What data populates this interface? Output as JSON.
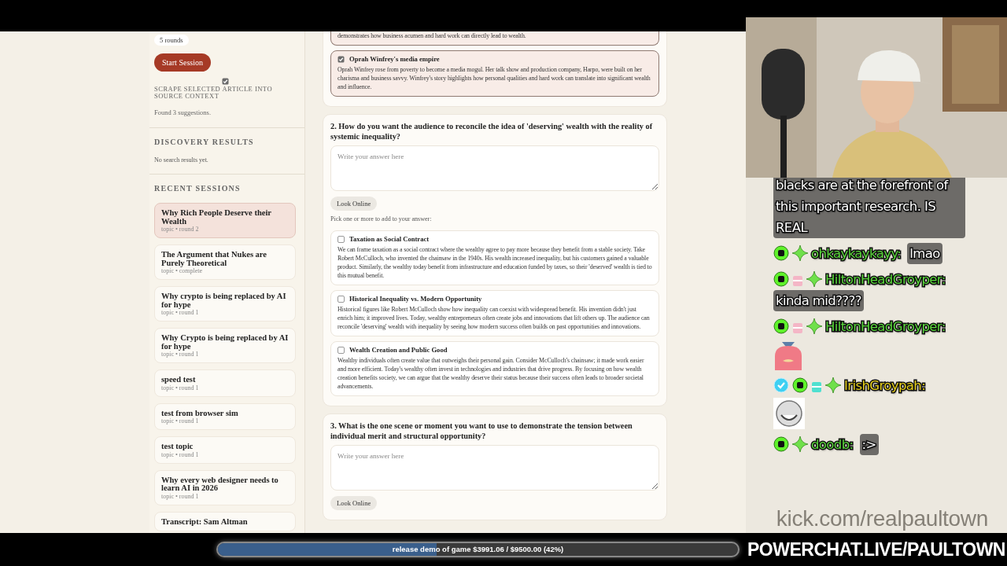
{
  "sidebar": {
    "rounds_chip": "5 rounds",
    "start_button": "Start Session",
    "scrape_option": {
      "label": "SCRAPE SELECTED ARTICLE INTO SOURCE CONTEXT",
      "checked": true
    },
    "status": "Found 3 suggestions.",
    "discovery": {
      "heading": "DISCOVERY RESULTS",
      "empty_text": "No search results yet."
    },
    "recent": {
      "heading": "RECENT SESSIONS",
      "sessions": [
        {
          "title": "Why Rich People Deserve their Wealth",
          "meta": "topic • round 2",
          "selected": true
        },
        {
          "title": "The Argument that Nukes are Purely Theoretical",
          "meta": "topic • complete",
          "selected": false
        },
        {
          "title": "Why crypto is being replaced by AI for hype",
          "meta": "topic • round 1",
          "selected": false
        },
        {
          "title": "Why Crypto is being replaced by AI for hype",
          "meta": "topic • round 1",
          "selected": false
        },
        {
          "title": "speed test",
          "meta": "topic • round 1",
          "selected": false
        },
        {
          "title": "test from browser sim",
          "meta": "topic • round 1",
          "selected": false
        },
        {
          "title": "test topic",
          "meta": "topic • round 1",
          "selected": false
        },
        {
          "title": "Why every web designer needs to learn AI in 2026",
          "meta": "topic • round 1",
          "selected": false
        },
        {
          "title": "Transcript: Sam Altman",
          "selected": false
        }
      ]
    }
  },
  "questions": [
    {
      "suggestions": [
        {
          "text": "demonstrates how business acumen and hard work can directly lead to wealth.",
          "checked": true
        },
        {
          "title": "Oprah Winfrey's media empire",
          "text": "Oprah Winfrey rose from poverty to become a media mogul. Her talk show and production company, Harpo, were built on her charisma and business savvy. Winfrey's story highlights how personal qualities and hard work can translate into significant wealth and influence.",
          "checked": true
        }
      ]
    },
    {
      "prompt": "2. How do you want the audience to reconcile the idea of 'deserving' wealth with the reality of systemic inequality?",
      "placeholder": "Write your answer here",
      "look_online": "Look Online",
      "pick_hint": "Pick one or more to add to your answer:",
      "suggestions": [
        {
          "title": "Taxation as Social Contract",
          "text": "We can frame taxation as a social contract where the wealthy agree to pay more because they benefit from a stable society. Take Robert McCulloch, who invented the chainsaw in the 1940s. His wealth increased inequality, but his customers gained a valuable product. Similarly, the wealthy today benefit from infrastructure and education funded by taxes, so their 'deserved' wealth is tied to this mutual benefit.",
          "checked": false
        },
        {
          "title": "Historical Inequality vs. Modern Opportunity",
          "text": "Historical figures like Robert McCulloch show how inequality can coexist with widespread benefit. His invention didn't just enrich him; it improved lives. Today, wealthy entrepreneurs often create jobs and innovations that lift others up. The audience can reconcile 'deserving' wealth with inequality by seeing how modern success often builds on past opportunities and innovations.",
          "checked": false
        },
        {
          "title": "Wealth Creation and Public Good",
          "text": "Wealthy individuals often create value that outweighs their personal gain. Consider McCulloch's chainsaw; it made work easier and more efficient. Today's wealthy often invest in technologies and industries that drive progress. By focusing on how wealth creation benefits society, we can argue that the wealthy deserve their status because their success often leads to broader societal advancements.",
          "checked": false
        }
      ]
    },
    {
      "prompt": "3. What is the one scene or moment you want to use to demonstrate the tension between individual merit and structural opportunity?",
      "placeholder": "Write your answer here",
      "look_online": "Look Online"
    }
  ],
  "chat": {
    "messages": [
      {
        "text": "blacks are at the forefront of this important research. IS REAL"
      },
      {
        "badges": [
          {
            "kind": "kick"
          },
          {
            "kind": "sparkle"
          }
        ],
        "user": "ohkaykaykayy:",
        "color": "#5ad63c",
        "text": "lmao"
      },
      {
        "badges": [
          {
            "kind": "kick"
          },
          {
            "kind": "gift",
            "color": "#f4b6c6"
          },
          {
            "kind": "sparkle"
          }
        ],
        "user": "HiltonHeadGroyper:",
        "color": "#5ad63c",
        "text": "kinda mid????"
      },
      {
        "badges": [
          {
            "kind": "kick"
          },
          {
            "kind": "gift",
            "color": "#f4b6c6"
          },
          {
            "kind": "sparkle"
          }
        ],
        "user": "HiltonHeadGroyper:",
        "color": "#5ad63c",
        "emote": {
          "kind": "seal"
        }
      },
      {
        "badges": [
          {
            "kind": "verified"
          },
          {
            "kind": "kick"
          },
          {
            "kind": "gift",
            "color": "#4fe0d0"
          },
          {
            "kind": "sparkle"
          }
        ],
        "user": "IrishGroypah:",
        "color": "#e6cf1c",
        "emote": {
          "kind": "grin"
        }
      },
      {
        "badges": [
          {
            "kind": "kick"
          },
          {
            "kind": "sparkle"
          }
        ],
        "user": "doodb:",
        "color": "#5ad63c",
        "text": ":>"
      }
    ],
    "watermark": "kick.com/realpaultown"
  },
  "goal_bar": {
    "text": "release demo of game $3991.06 / $9500.00 (42%)",
    "level": 0.42
  },
  "brand": "POWERCHAT.LIVE/PAULTOWN"
}
